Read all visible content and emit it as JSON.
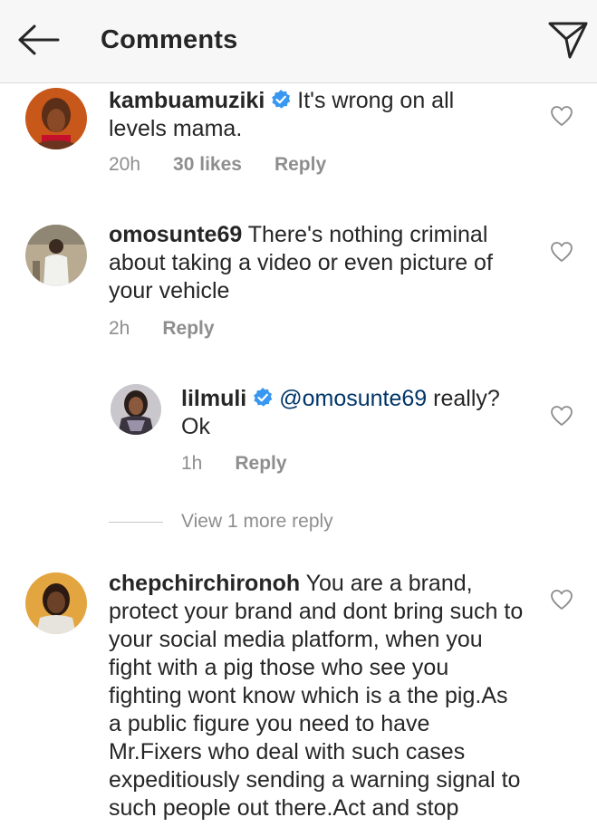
{
  "header": {
    "title": "Comments",
    "back_icon": "arrow-left-icon",
    "send_icon": "paper-plane-icon"
  },
  "comments": [
    {
      "username": "kambuamuziki",
      "verified": true,
      "text": "It's wrong on all levels mama.",
      "time": "20h",
      "likes": "30 likes",
      "reply": "Reply"
    },
    {
      "username": "omosunte69",
      "verified": false,
      "text": "There's nothing criminal about taking a video or even picture of your vehicle",
      "time": "2h",
      "reply": "Reply"
    },
    {
      "username": "chepchirchironoh",
      "verified": false,
      "text": "You are a brand, protect your brand and dont bring such to your social media platform, when you fight with a pig those who see you fighting wont know which is a the pig.As a public figure you need to have Mr.Fixers who deal with such cases expeditiously sending a warning signal to such people out there.Act and stop"
    }
  ],
  "reply_thread": {
    "username": "lilmuli",
    "verified": true,
    "mention": "@omosunte69",
    "text": "really? Ok",
    "time": "1h",
    "reply": "Reply",
    "view_more": "View 1 more reply"
  },
  "colors": {
    "verified": "#3897f0",
    "mention": "#003569",
    "meta": "#8e8e8e",
    "header_bg": "#f7f7f7"
  }
}
